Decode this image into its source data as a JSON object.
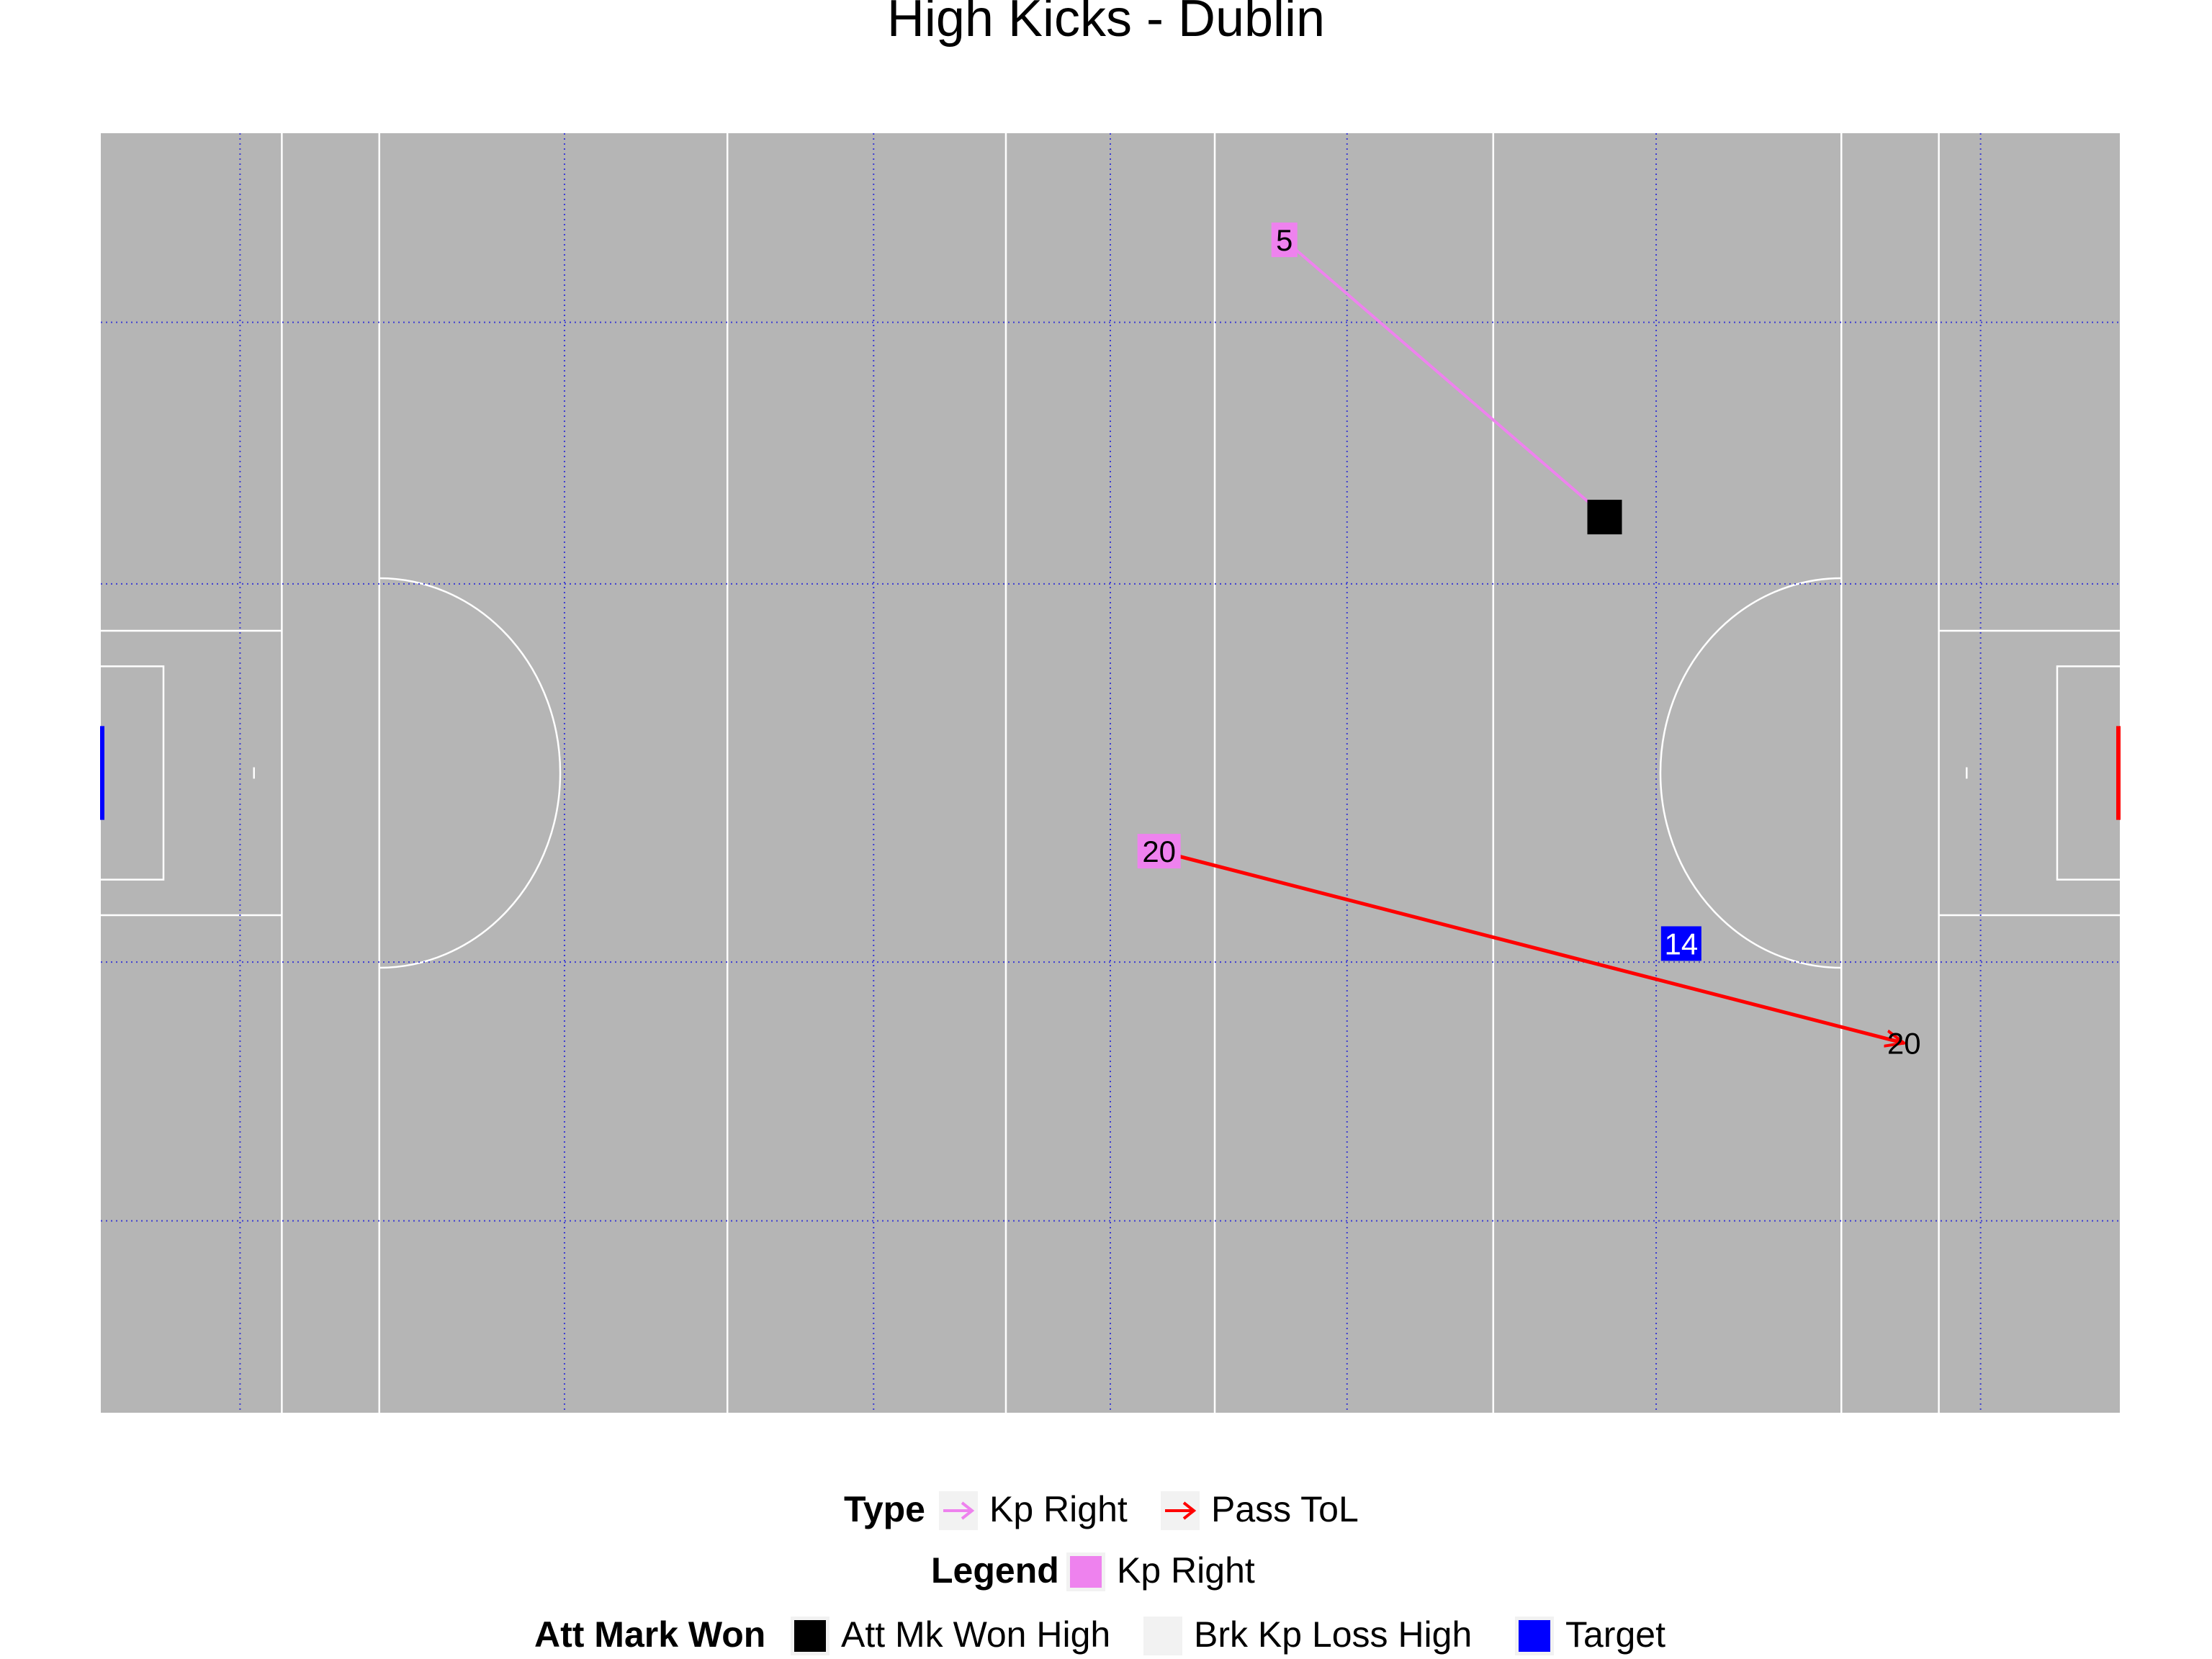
{
  "chart_data": {
    "type": "scatter",
    "title": "High Kicks - Dublin",
    "xlim": [
      0,
      145
    ],
    "ylim": [
      0,
      90
    ],
    "colors": {
      "pitch": "#b5b5b5",
      "pitch_lines": "#ffffff",
      "grid": "#3c3cd2",
      "kp_right": "#ee82ee",
      "pass_tol": "#ff0000",
      "att_mk_won_high": "#000000",
      "brk_kp_loss_high": "#f2f2f2",
      "target": "#0000ff",
      "goal_left": "#0000ff",
      "goal_right": "#ff0000"
    },
    "kicks": [
      {
        "type": "Kp Right",
        "label": "5",
        "x": 85,
        "y": 82.5,
        "xend": 107.5,
        "yend": 63.5,
        "color": "#ee82ee"
      },
      {
        "type": "Pass ToL",
        "label": "20",
        "x": 76,
        "y": 39.5,
        "xend": 129.5,
        "yend": 26,
        "color": "#ff0000",
        "end_label": "20"
      }
    ],
    "points": [
      {
        "category": "Att Mk Won High",
        "x": 108,
        "y": 63,
        "color": "#000000"
      },
      {
        "category": "Target",
        "label": "14",
        "x": 113.5,
        "y": 33,
        "color": "#0000ff"
      }
    ],
    "legends": [
      {
        "title": "Type",
        "items": [
          {
            "label": "Kp Right",
            "color": "#ee82ee",
            "kind": "arrow"
          },
          {
            "label": "Pass ToL",
            "color": "#ff0000",
            "kind": "arrow"
          }
        ]
      },
      {
        "title": "Legend",
        "items": [
          {
            "label": "Kp Right",
            "color": "#ee82ee",
            "kind": "box"
          }
        ]
      },
      {
        "title": "Att Mark Won",
        "items": [
          {
            "label": "Att Mk Won High",
            "color": "#000000",
            "kind": "box"
          },
          {
            "label": "Brk Kp Loss High",
            "color": "#f2f2f2",
            "kind": "box"
          },
          {
            "label": "Target",
            "color": "#0000ff",
            "kind": "box"
          }
        ]
      }
    ]
  }
}
